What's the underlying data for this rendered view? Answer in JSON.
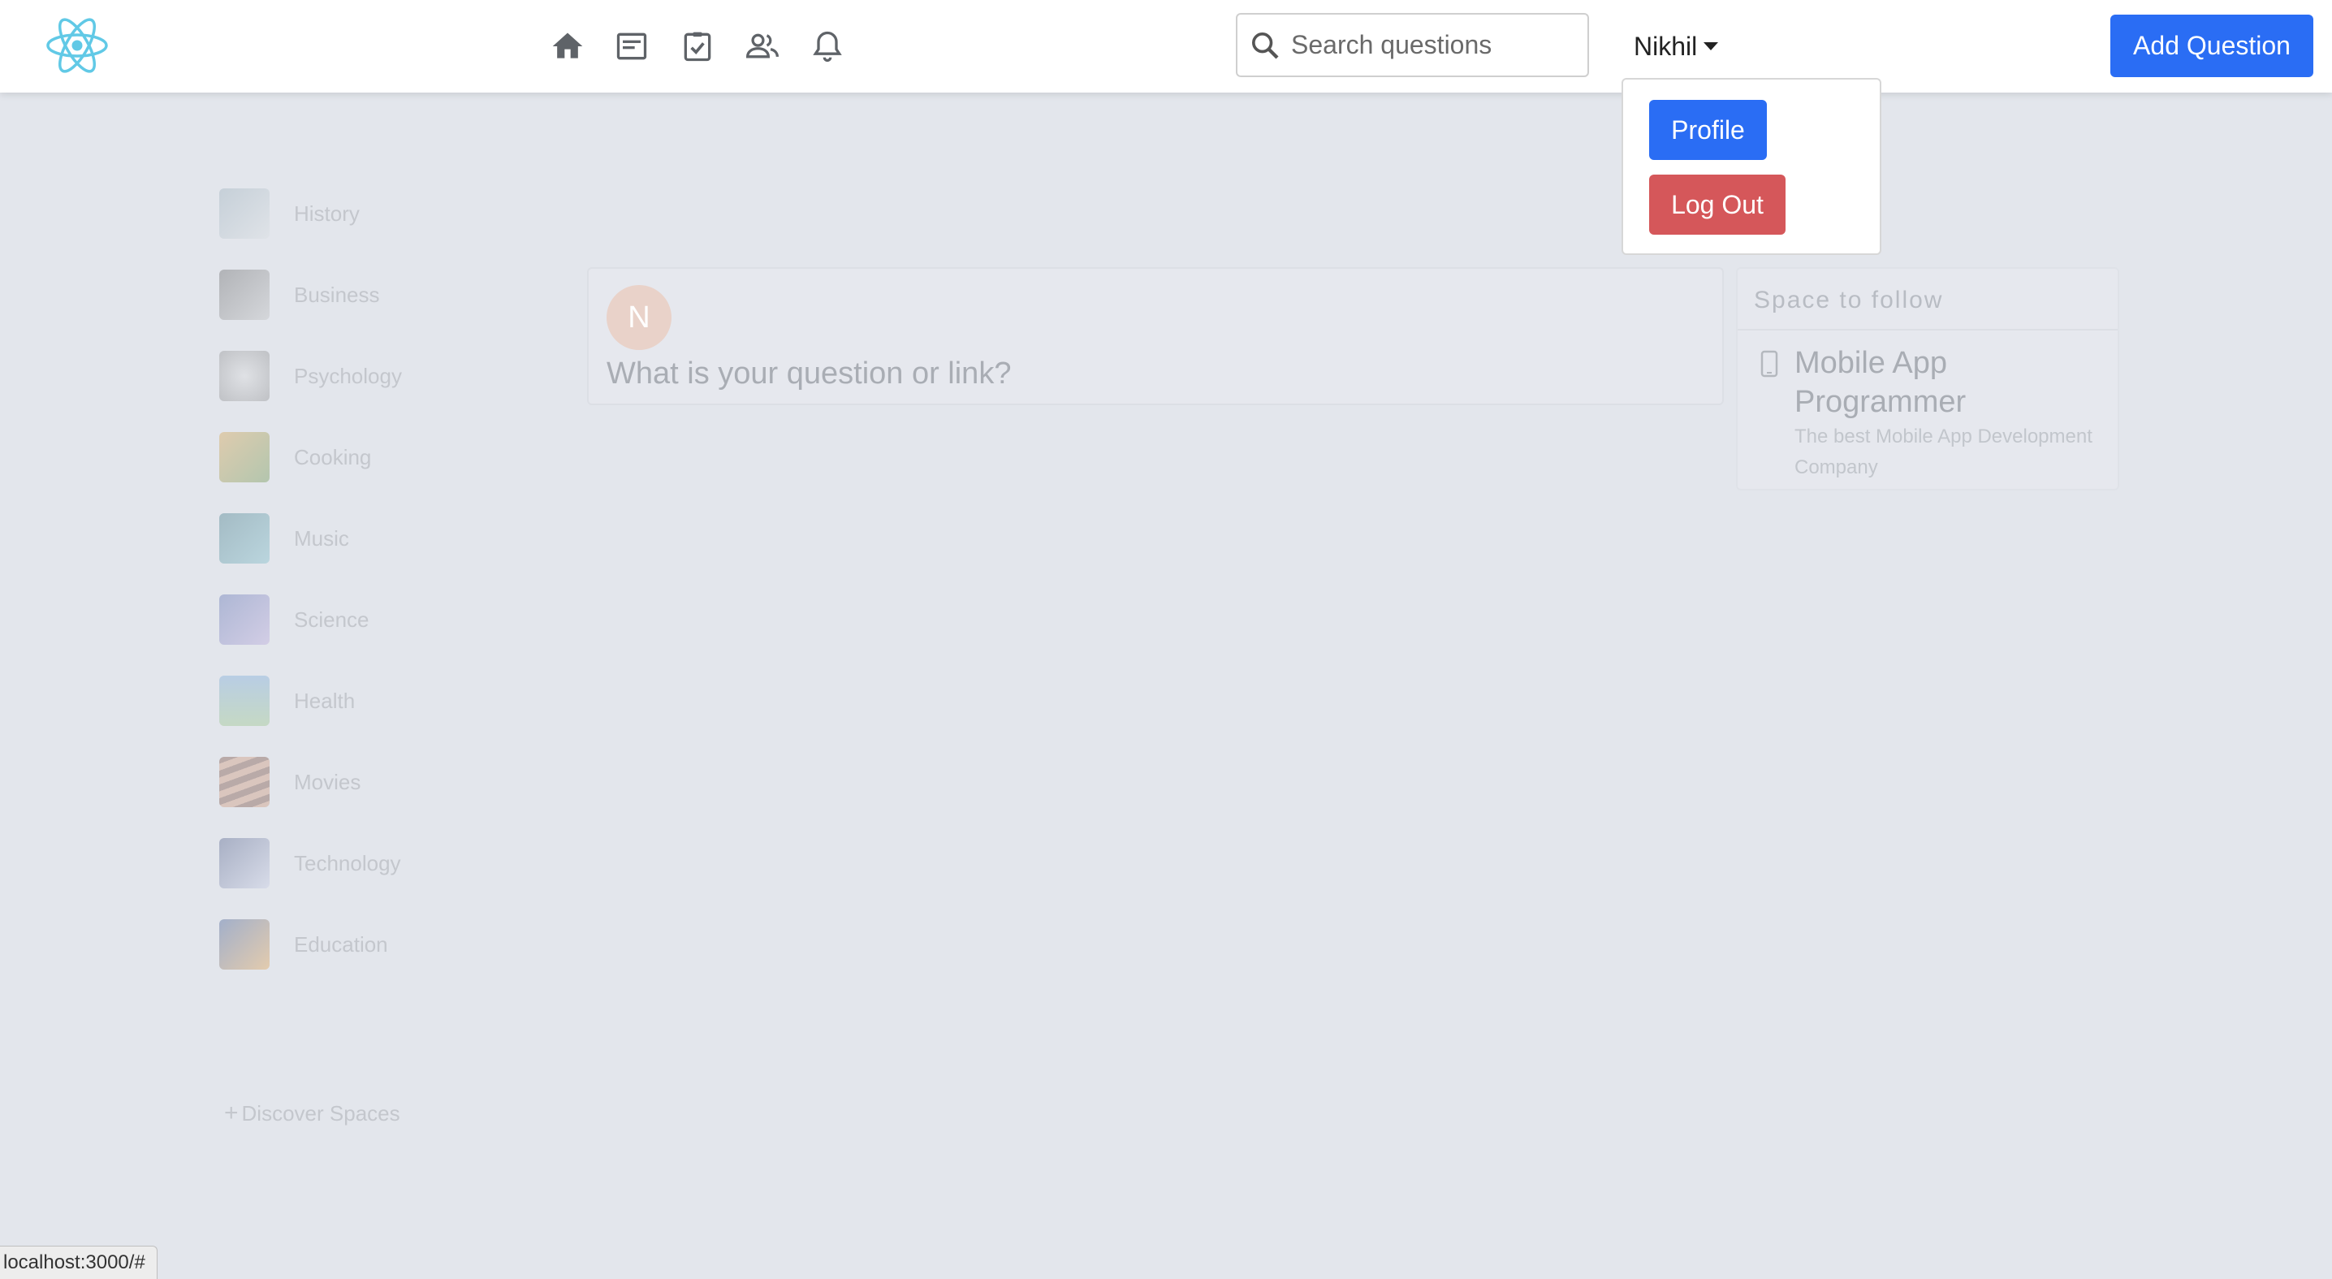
{
  "navbar": {
    "logo_icon": "react-atom-icon",
    "icons": [
      "home-icon",
      "newspaper-icon",
      "checkbox-icon",
      "people-icon",
      "bell-icon"
    ],
    "search_placeholder": "Search questions",
    "user_name": "Nikhil",
    "add_question_label": "Add Question",
    "accent_color": "#2a6df4"
  },
  "user_menu": {
    "profile_label": "Profile",
    "logout_label": "Log Out",
    "logout_color": "#d5575a"
  },
  "sidebar": {
    "items": [
      {
        "label": "History"
      },
      {
        "label": "Business"
      },
      {
        "label": "Psychology"
      },
      {
        "label": "Cooking"
      },
      {
        "label": "Music"
      },
      {
        "label": "Science"
      },
      {
        "label": "Health"
      },
      {
        "label": "Movies"
      },
      {
        "label": "Technology"
      },
      {
        "label": "Education"
      }
    ],
    "discover_label": "Discover Spaces"
  },
  "ask_box": {
    "avatar_letter": "N",
    "prompt": "What is your question or link?"
  },
  "spaces_widget": {
    "header": "Space to follow",
    "space_title": "Mobile App Programmer",
    "space_description": "The best Mobile App Development Company"
  },
  "status_bar": {
    "url": "localhost:3000/#"
  }
}
